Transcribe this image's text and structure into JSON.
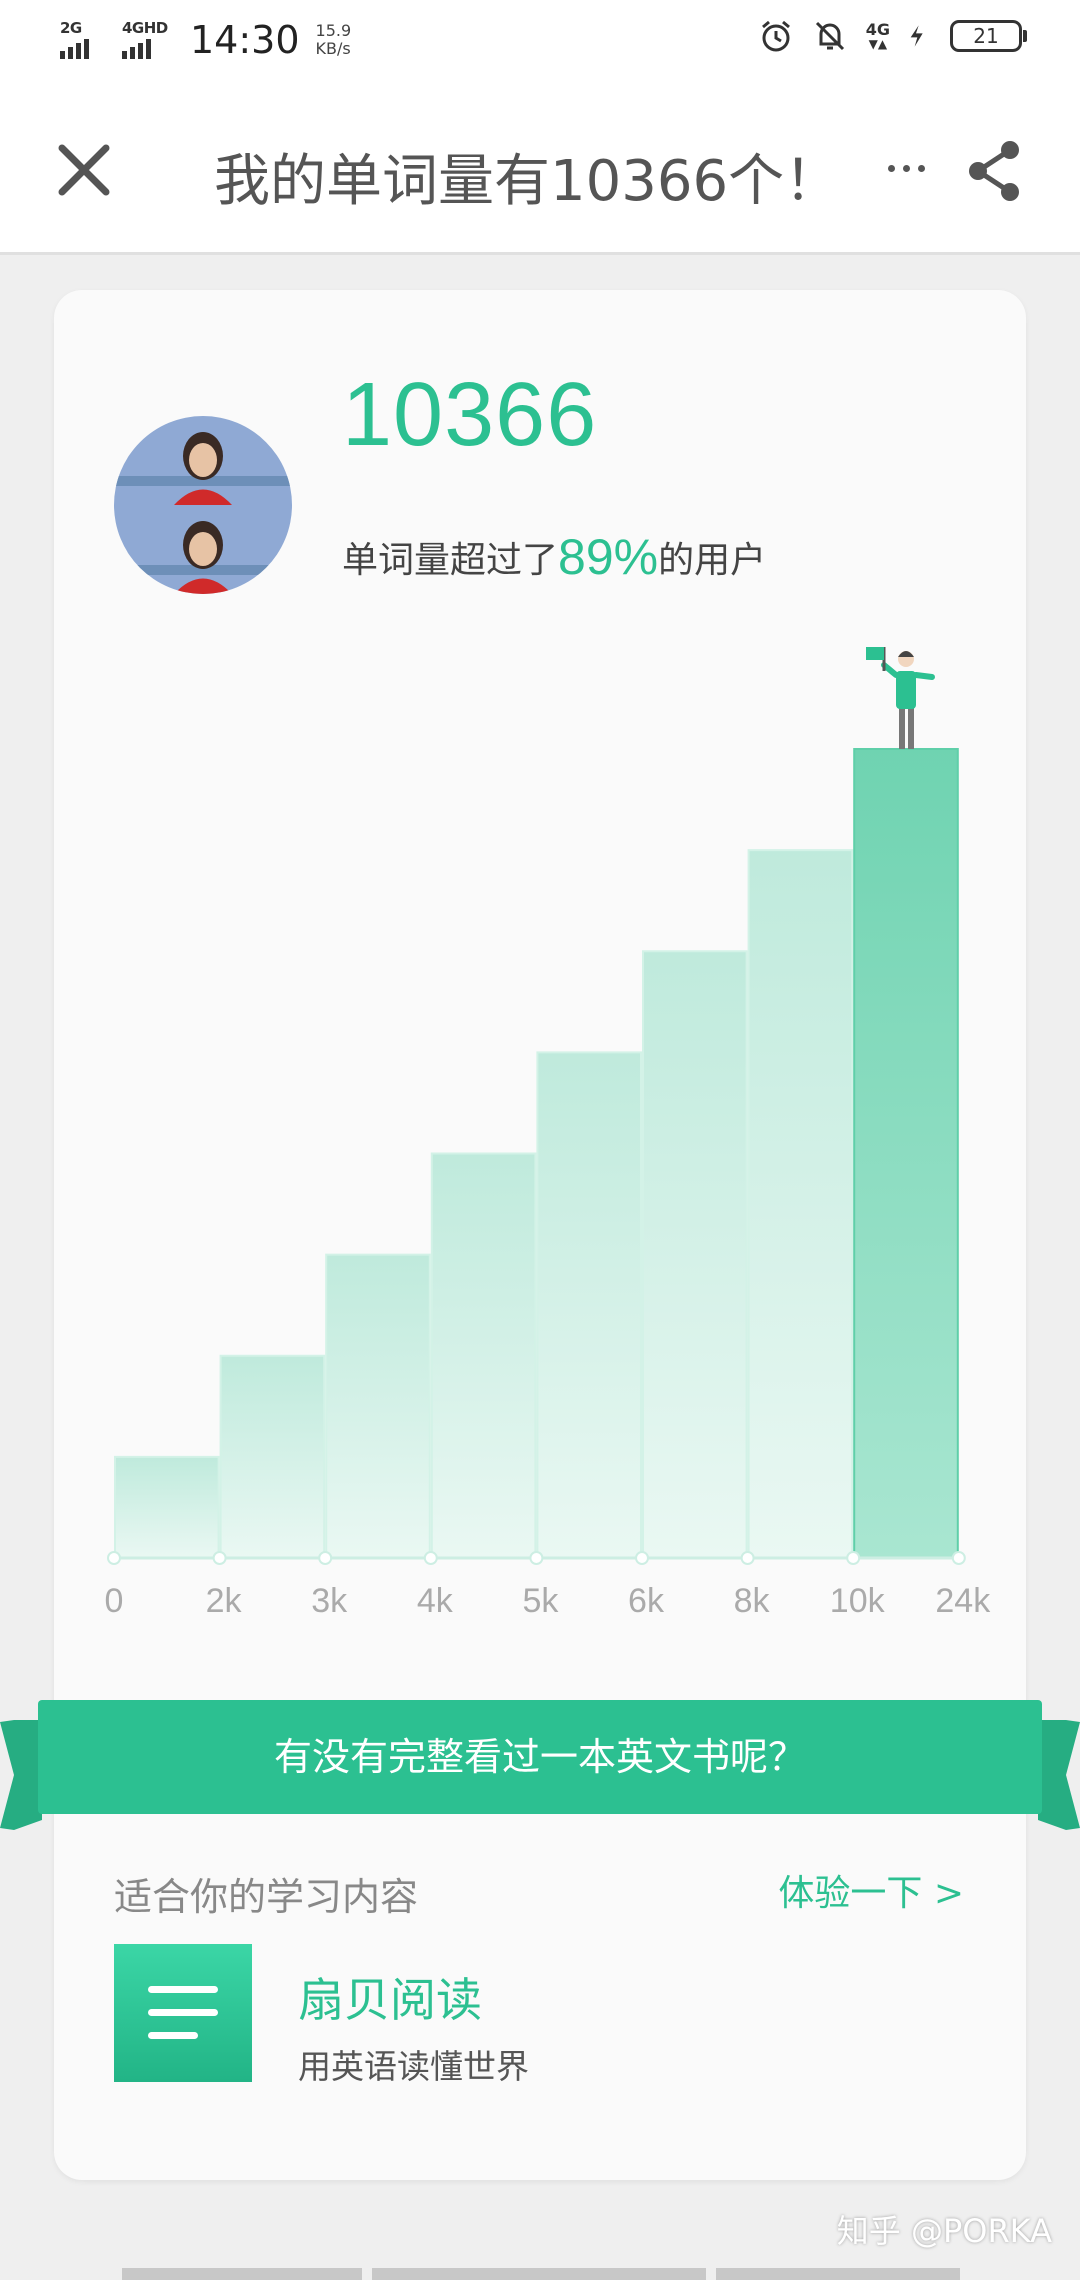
{
  "status_bar": {
    "sim1": "2G",
    "sim2": "4GHD",
    "time": "14:30",
    "speed_value": "15.9",
    "speed_unit": "KB/s",
    "network": "4G",
    "battery": "21",
    "icons": [
      "alarm-icon",
      "mute-bell-icon",
      "signal-4g-icon",
      "charging-icon",
      "battery-icon"
    ]
  },
  "titlebar": {
    "title": "我的单词量有10366个！",
    "icons": [
      "close-icon",
      "more-icon",
      "share-icon"
    ]
  },
  "profile": {
    "word_count": "10366",
    "exceed_prefix": "单词量超过了",
    "exceed_percent": "89%",
    "exceed_suffix": "的用户"
  },
  "chart_data": {
    "type": "bar",
    "categories": [
      "0",
      "2k",
      "3k",
      "4k",
      "5k",
      "6k",
      "8k",
      "10k",
      "24k"
    ],
    "values": [
      1,
      2,
      3,
      4,
      5,
      6,
      7,
      8
    ],
    "highlight_index": 7,
    "colors": {
      "bar": "#c6eee1",
      "highlight": "#5fd1ab",
      "accent": "#2cc091"
    }
  },
  "ribbon": {
    "text": "有没有完整看过一本英文书呢？"
  },
  "recommend": {
    "section_label": "适合你的学习内容",
    "try_label": "体验一下 >",
    "app_name": "扇贝阅读",
    "app_desc": "用英语读懂世界"
  },
  "watermark": "知乎 @PORKA"
}
